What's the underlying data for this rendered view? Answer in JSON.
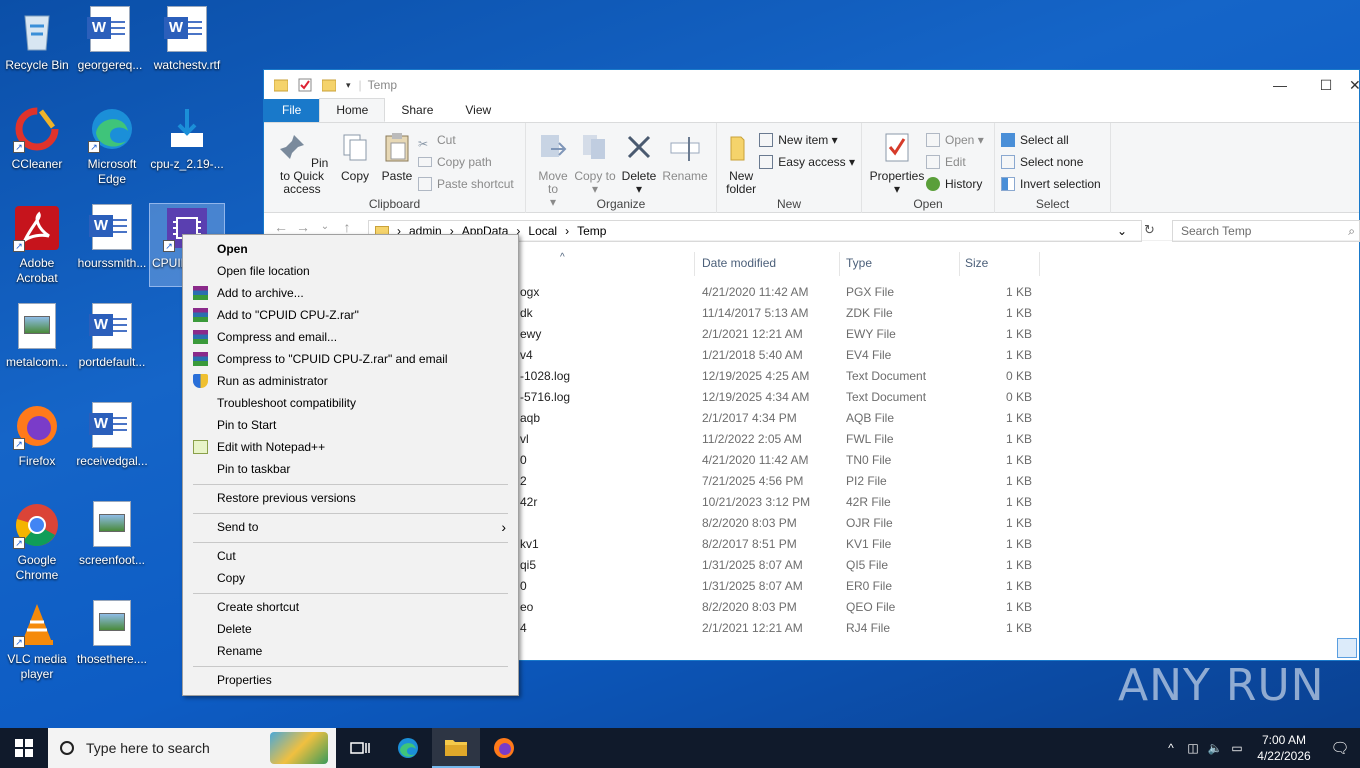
{
  "desktop": {
    "icons": [
      {
        "label": "Recycle Bin"
      },
      {
        "label": "georgereq..."
      },
      {
        "label": "watchestv.rtf"
      },
      {
        "label": "CCleaner"
      },
      {
        "label": "Microsoft Edge"
      },
      {
        "label": "cpu-z_2.19-..."
      },
      {
        "label": "Adobe Acrobat"
      },
      {
        "label": "hourssmith..."
      },
      {
        "label": "CPUID CPU-Z"
      },
      {
        "label": "metalcom..."
      },
      {
        "label": "portdefault..."
      },
      {
        "label": "Firefox"
      },
      {
        "label": "receivedgal..."
      },
      {
        "label": "Google Chrome"
      },
      {
        "label": "screenfoot..."
      },
      {
        "label": "VLC media player"
      },
      {
        "label": "thosethere...."
      }
    ]
  },
  "explorer": {
    "title": "Temp",
    "tabs": {
      "file": "File",
      "home": "Home",
      "share": "Share",
      "view": "View"
    },
    "ribbon": {
      "clipboard": {
        "label": "Clipboard",
        "pin": "Pin to Quick access",
        "copy": "Copy",
        "paste": "Paste",
        "cut": "Cut",
        "copy_path": "Copy path",
        "paste_shortcut": "Paste shortcut"
      },
      "organize": {
        "label": "Organize",
        "move_to": "Move to",
        "copy_to": "Copy to",
        "delete": "Delete",
        "rename": "Rename"
      },
      "new": {
        "label": "New",
        "new_folder": "New folder",
        "new_item": "New item",
        "easy_access": "Easy access"
      },
      "open": {
        "label": "Open",
        "properties": "Properties",
        "open": "Open",
        "edit": "Edit",
        "history": "History"
      },
      "select": {
        "label": "Select",
        "select_all": "Select all",
        "select_none": "Select none",
        "invert": "Invert selection"
      }
    },
    "address": {
      "path": [
        "admin",
        "AppData",
        "Local",
        "Temp"
      ]
    },
    "search_placeholder": "Search Temp",
    "columns": {
      "date": "Date modified",
      "type": "Type",
      "size": "Size"
    },
    "files": [
      {
        "name": "ogx",
        "date": "4/21/2020 11:42 AM",
        "type": "PGX File",
        "size": "1 KB"
      },
      {
        "name": "dk",
        "date": "11/14/2017 5:13 AM",
        "type": "ZDK File",
        "size": "1 KB"
      },
      {
        "name": "ewy",
        "date": "2/1/2021 12:21 AM",
        "type": "EWY File",
        "size": "1 KB"
      },
      {
        "name": "v4",
        "date": "1/21/2018 5:40 AM",
        "type": "EV4 File",
        "size": "1 KB"
      },
      {
        "name": "-1028.log",
        "date": "12/19/2025 4:25 AM",
        "type": "Text Document",
        "size": "0 KB"
      },
      {
        "name": "-5716.log",
        "date": "12/19/2025 4:34 AM",
        "type": "Text Document",
        "size": "0 KB"
      },
      {
        "name": "aqb",
        "date": "2/1/2017 4:34 PM",
        "type": "AQB File",
        "size": "1 KB"
      },
      {
        "name": "vl",
        "date": "11/2/2022 2:05 AM",
        "type": "FWL File",
        "size": "1 KB"
      },
      {
        "name": "0",
        "date": "4/21/2020 11:42 AM",
        "type": "TN0 File",
        "size": "1 KB"
      },
      {
        "name": "2",
        "date": "7/21/2025 4:56 PM",
        "type": "PI2 File",
        "size": "1 KB"
      },
      {
        "name": "42r",
        "date": "10/21/2023 3:12 PM",
        "type": "42R File",
        "size": "1 KB"
      },
      {
        "name": "",
        "date": "8/2/2020 8:03 PM",
        "type": "OJR File",
        "size": "1 KB"
      },
      {
        "name": "kv1",
        "date": "8/2/2017 8:51 PM",
        "type": "KV1 File",
        "size": "1 KB"
      },
      {
        "name": "qi5",
        "date": "1/31/2025 8:07 AM",
        "type": "QI5 File",
        "size": "1 KB"
      },
      {
        "name": "0",
        "date": "1/31/2025 8:07 AM",
        "type": "ER0 File",
        "size": "1 KB"
      },
      {
        "name": "eo",
        "date": "8/2/2020 8:03 PM",
        "type": "QEO File",
        "size": "1 KB"
      },
      {
        "name": "4",
        "date": "2/1/2021 12:21 AM",
        "type": "RJ4 File",
        "size": "1 KB"
      }
    ]
  },
  "context_menu": {
    "open": "Open",
    "open_location": "Open file location",
    "add_archive": "Add to archive...",
    "add_rar": "Add to \"CPUID CPU-Z.rar\"",
    "compress_email": "Compress and email...",
    "compress_rar_email": "Compress to \"CPUID CPU-Z.rar\" and email",
    "run_admin": "Run as administrator",
    "troubleshoot": "Troubleshoot compatibility",
    "pin_start": "Pin to Start",
    "edit_notepad": "Edit with Notepad++",
    "pin_taskbar": "Pin to taskbar",
    "restore": "Restore previous versions",
    "send_to": "Send to",
    "cut": "Cut",
    "copy": "Copy",
    "create_shortcut": "Create shortcut",
    "delete": "Delete",
    "rename": "Rename",
    "properties": "Properties"
  },
  "taskbar": {
    "search_placeholder": "Type here to search",
    "time": "7:00 AM",
    "date": "4/22/2026"
  },
  "watermark": "ANY RUN",
  "colors": {
    "accent": "#1979ca",
    "taskbar": "#101a2b",
    "desktop": "#0d5cc4"
  }
}
